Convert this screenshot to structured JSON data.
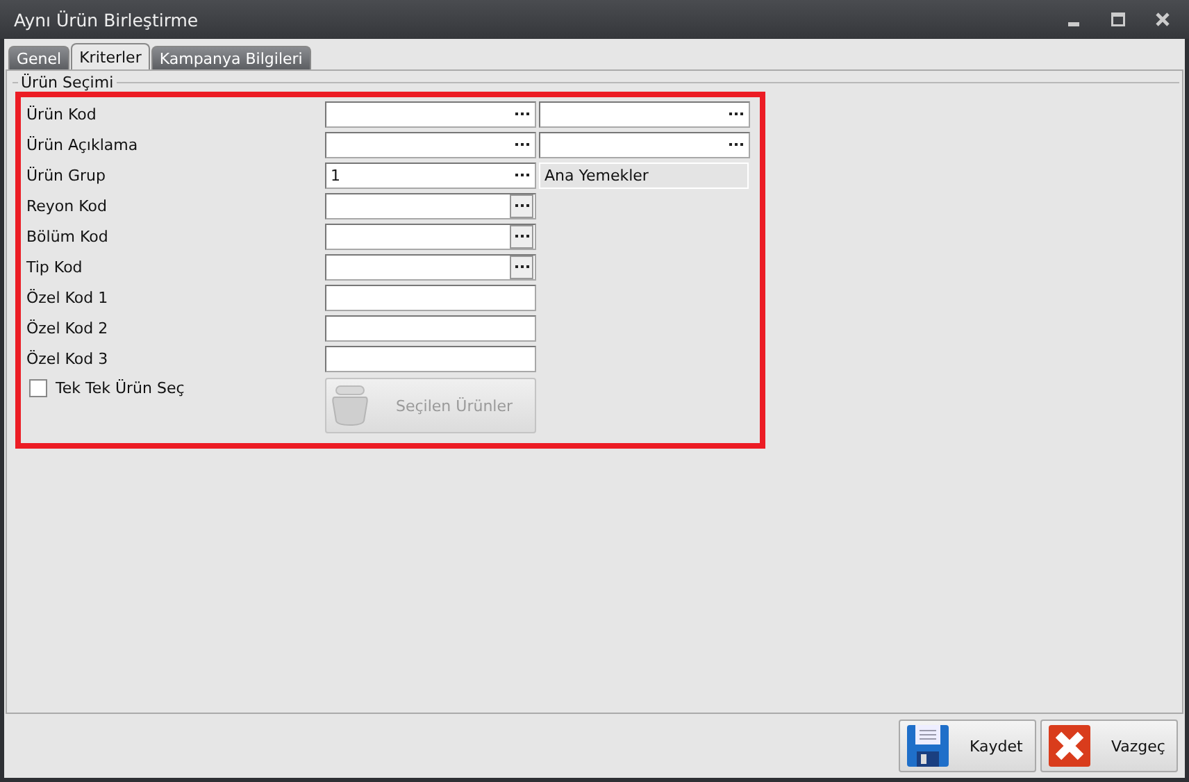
{
  "window": {
    "title": "Aynı Ürün Birleştirme"
  },
  "tabs": [
    {
      "label": "Genel",
      "selected": false
    },
    {
      "label": "Kriterler",
      "selected": true
    },
    {
      "label": "Kampanya Bilgileri",
      "selected": false
    }
  ],
  "group": {
    "title": "Ürün Seçimi",
    "highlighted": true
  },
  "rows": [
    {
      "kind": "range",
      "label": "Ürün Kod"
    },
    {
      "kind": "range",
      "label": "Ürün Açıklama"
    },
    {
      "kind": "described",
      "label": "Ürün Grup",
      "value": "1",
      "description": "Ana Yemekler"
    },
    {
      "kind": "lookup",
      "label": "Reyon Kod"
    },
    {
      "kind": "lookup",
      "label": "Bölüm Kod"
    },
    {
      "kind": "lookup",
      "label": "Tip Kod"
    },
    {
      "kind": "text",
      "label": "Özel Kod 1"
    },
    {
      "kind": "text",
      "label": "Özel Kod 2"
    },
    {
      "kind": "text",
      "label": "Özel Kod 3"
    }
  ],
  "pick": {
    "label": "Tek Tek Ürün Seç",
    "checked": false,
    "button": "Seçilen Ürünler",
    "disabled": true
  },
  "buttons": [
    {
      "kind": "save",
      "label": "Kaydet"
    },
    {
      "kind": "cancel",
      "label": "Vazgeç"
    }
  ]
}
